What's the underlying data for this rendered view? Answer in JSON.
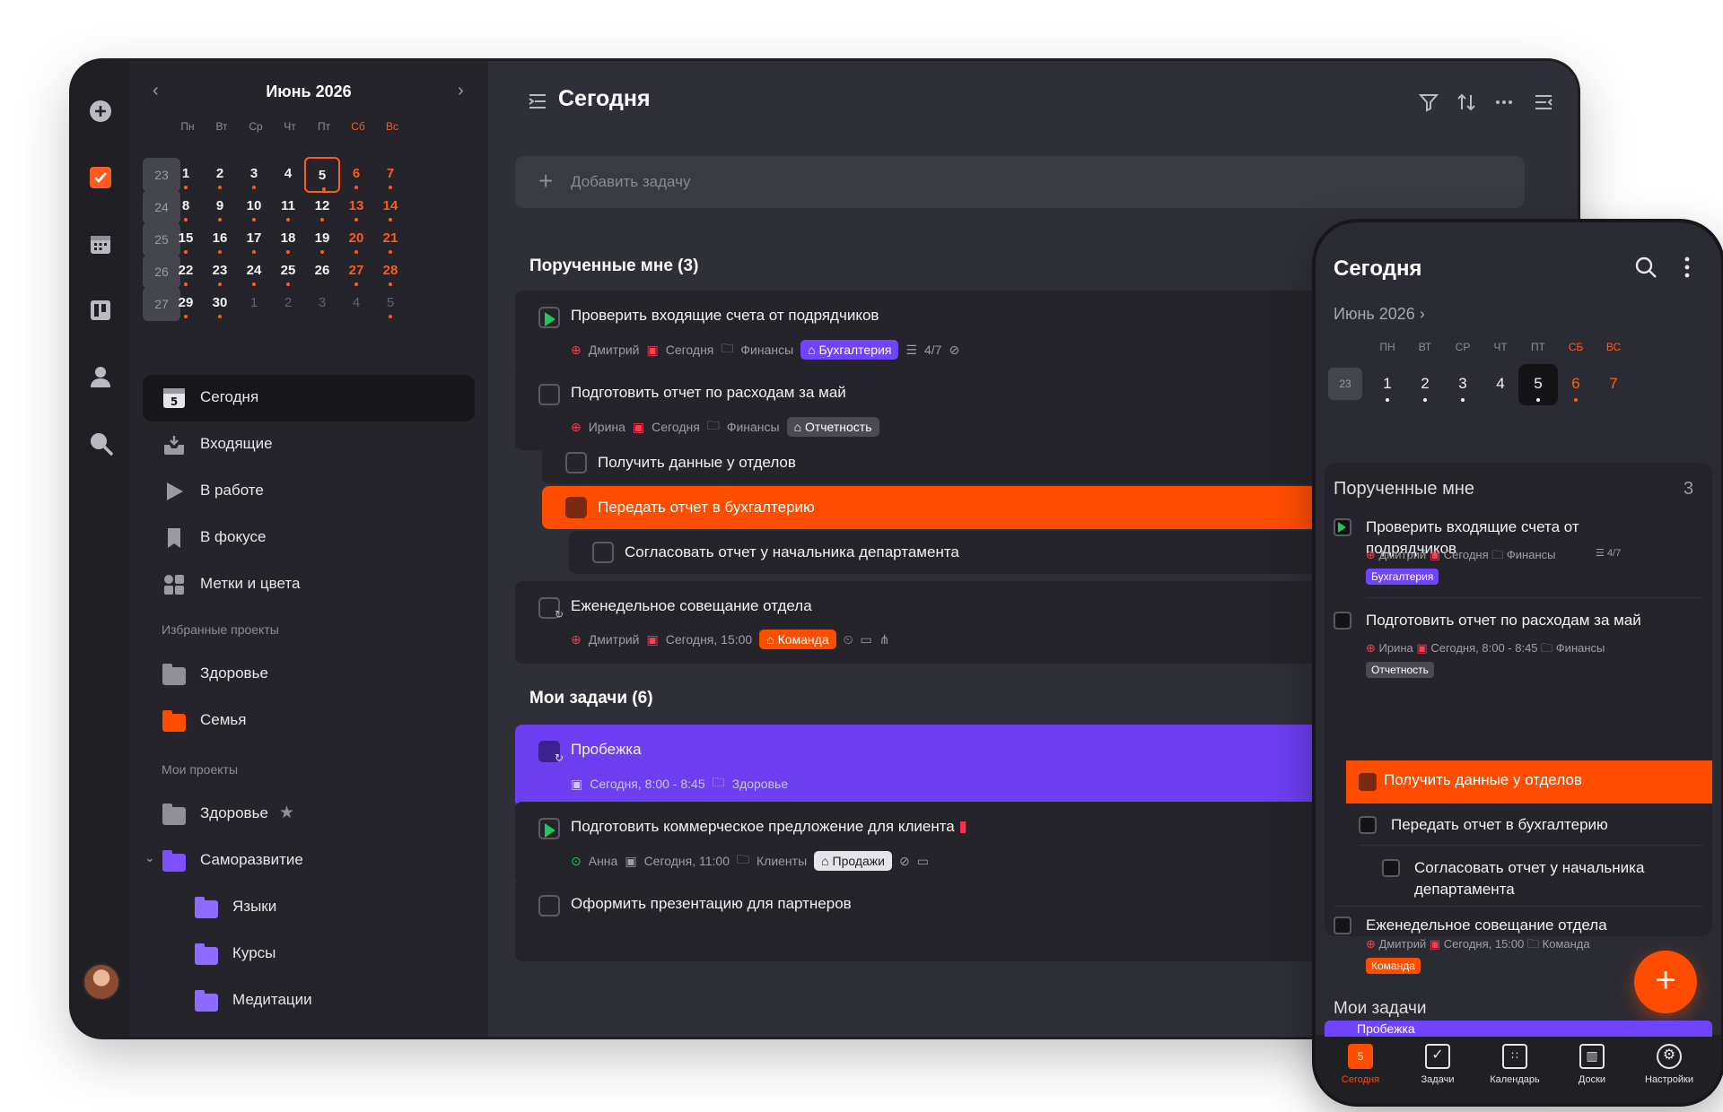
{
  "desktop": {
    "calendar": {
      "title": "Июнь 2026",
      "weekdays": [
        "Пн",
        "Вт",
        "Ср",
        "Чт",
        "Пт",
        "Сб",
        "Вс"
      ],
      "weeks": [
        "23",
        "24",
        "25",
        "26",
        "27"
      ],
      "days": [
        [
          "1",
          "2",
          "3",
          "4",
          "5",
          "6",
          "7"
        ],
        [
          "8",
          "9",
          "10",
          "11",
          "12",
          "13",
          "14"
        ],
        [
          "15",
          "16",
          "17",
          "18",
          "19",
          "20",
          "21"
        ],
        [
          "22",
          "23",
          "24",
          "25",
          "26",
          "27",
          "28"
        ],
        [
          "29",
          "30",
          "1",
          "2",
          "3",
          "4",
          "5"
        ]
      ]
    },
    "nav": [
      {
        "label": "Сегодня",
        "icon_text": "5"
      },
      {
        "label": "Входящие"
      },
      {
        "label": "В работе"
      },
      {
        "label": "В фокусе"
      },
      {
        "label": "Метки и цвета"
      }
    ],
    "fav_label": "Избранные проекты",
    "fav_projects": [
      "Здоровье",
      "Семья"
    ],
    "my_label": "Мои проекты",
    "my_projects": [
      "Здоровье",
      "Саморазвитие",
      "Языки",
      "Курсы",
      "Медитации"
    ],
    "header": {
      "title": "Сегодня"
    },
    "add_task": "Добавить задачу",
    "group1": "Порученные мне (3)",
    "group2": "Мои задачи (6)",
    "tasks": {
      "t1": {
        "title": "Проверить входящие счета от подрядчиков",
        "person": "Дмитрий",
        "date": "Сегодня",
        "project": "Финансы",
        "tag": "Бухгалтерия",
        "progress": "4/7"
      },
      "t2": {
        "title": "Подготовить отчет по расходам за май",
        "person": "Ирина",
        "date": "Сегодня",
        "project": "Финансы",
        "tag": "Отчетность"
      },
      "s1": {
        "title": "Получить данные у отделов"
      },
      "s2": {
        "title": "Передать отчет в бухгалтерию"
      },
      "s3": {
        "title": "Согласовать отчет у начальника департамента"
      },
      "t3": {
        "title": "Еженедельное совещание отдела",
        "person": "Дмитрий",
        "date": "Сегодня, 15:00",
        "tag": "Команда"
      },
      "t4": {
        "title": "Пробежка",
        "date": "Сегодня, 8:00 - 8:45",
        "project": "Здоровье"
      },
      "t5": {
        "title": "Подготовить коммерческое предложение для клиента",
        "person": "Анна",
        "date": "Сегодня, 11:00",
        "project": "Клиенты",
        "tag": "Продажи"
      },
      "t6": {
        "title": "Оформить презентацию для партнеров"
      }
    },
    "colors": {
      "accent": "#ff4d00",
      "purple": "#6d3ff0",
      "folder_gray": "#8f8f99"
    }
  },
  "phone": {
    "title": "Сегодня",
    "month": "Июнь 2026",
    "weekdays": [
      "ПН",
      "ВТ",
      "СР",
      "ЧТ",
      "ПТ",
      "СБ",
      "ВС"
    ],
    "week": "23",
    "days": [
      "1",
      "2",
      "3",
      "4",
      "5",
      "6",
      "7"
    ],
    "sec1": "Порученные мне",
    "sec1_count": "3",
    "t1": {
      "title": "Проверить входящие счета от подрядчиков",
      "meta_person": "Дмитрий",
      "meta_date": "Сегодня",
      "meta_project": "Финансы",
      "progress": "4/7",
      "tag": "Бухгалтерия"
    },
    "t2": {
      "title": "Подготовить отчет по расходам за май",
      "meta_person": "Ирина",
      "meta_date": "Сегодня, 8:00 - 8:45",
      "meta_project": "Финансы",
      "tag": "Отчетность"
    },
    "s1": "Получить данные у отделов",
    "s2": "Передать отчет в бухгалтерию",
    "s3": "Согласовать отчет у начальника департамента",
    "t3": {
      "title": "Еженедельное совещание отдела",
      "meta_person": "Дмитрий",
      "meta_date": "Сегодня, 15:00",
      "meta_project": "Команда",
      "tag": "Команда"
    },
    "sec2": "Мои задачи",
    "t4": {
      "title": "Пробежка"
    },
    "fab": "+",
    "tabs": [
      {
        "label": "Сегодня",
        "badge": "5"
      },
      {
        "label": "Задачи"
      },
      {
        "label": "Календарь"
      },
      {
        "label": "Доски"
      },
      {
        "label": "Настройки"
      }
    ]
  }
}
